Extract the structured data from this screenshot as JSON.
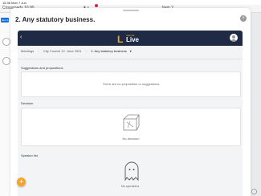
{
  "status_bar": {
    "time": "15.36  Mon 7 Jun",
    "right": ""
  },
  "background_app": {
    "left_text": "Crossroads  10.00",
    "center_text": "▮ ×",
    "right_text": "Item 2",
    "side_tag": "Item 1"
  },
  "modal": {
    "title": "2. Any statutory business.",
    "close_glyph": "×"
  },
  "app_bar": {
    "back_glyph": "‹",
    "logo_letter": "L",
    "logo_small": "Agenda",
    "logo_word": "Live"
  },
  "breadcrumbs": {
    "items": [
      "Meetings",
      "City Council 12. June 2021",
      "2. Any statutory business"
    ],
    "separator": "›",
    "dropdown_glyph": "▾"
  },
  "sections": {
    "suggestions": {
      "heading": "Suggestions and propositions",
      "empty_text": "There are no proposition or suggestions"
    },
    "decision": {
      "heading": "Decision",
      "empty_text": "No decision"
    },
    "speaker_list": {
      "heading": "Speaker list",
      "empty_text": "No speakers"
    }
  },
  "fab": {
    "glyph": "+"
  },
  "help": {
    "glyph": "?"
  },
  "colors": {
    "app_bar": "#1f2a44",
    "accent": "#f5a524"
  }
}
